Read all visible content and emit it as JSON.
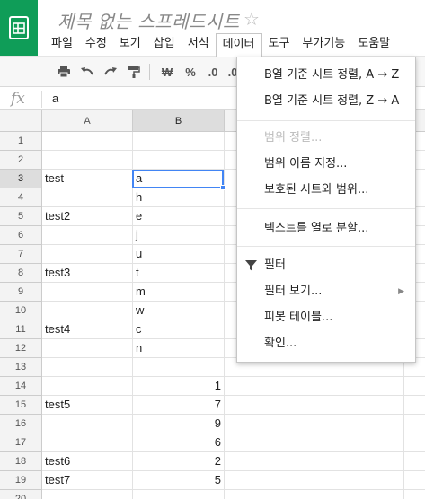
{
  "app": {
    "title": "제목 없는 스프레드시트",
    "star": "☆",
    "brand_color": "#0f9d58"
  },
  "menubar": {
    "items": [
      "파일",
      "수정",
      "보기",
      "삽입",
      "서식",
      "데이터",
      "도구",
      "부가기능",
      "도움말"
    ],
    "active_index": 5
  },
  "toolbar": {
    "print_icon": "print-icon",
    "undo_icon": "undo-icon",
    "redo_icon": "redo-icon",
    "paint_format_icon": "paint-format-icon",
    "currency_label": "₩",
    "percent_label": "%",
    "decimal_decrease_label": ".0",
    "decimal_increase_label": ".0"
  },
  "formula_bar": {
    "fx_label": "fx",
    "value": "a"
  },
  "grid": {
    "columns": [
      "A",
      "B"
    ],
    "selected_column": "B",
    "selected_row": 3,
    "rows": [
      {
        "n": "1",
        "a": "",
        "b": "",
        "b_num": false
      },
      {
        "n": "2",
        "a": "",
        "b": "",
        "b_num": false
      },
      {
        "n": "3",
        "a": "test",
        "b": "a",
        "b_num": false
      },
      {
        "n": "4",
        "a": "",
        "b": "h",
        "b_num": false
      },
      {
        "n": "5",
        "a": "test2",
        "b": "e",
        "b_num": false
      },
      {
        "n": "6",
        "a": "",
        "b": "j",
        "b_num": false
      },
      {
        "n": "7",
        "a": "",
        "b": "u",
        "b_num": false
      },
      {
        "n": "8",
        "a": "test3",
        "b": "t",
        "b_num": false
      },
      {
        "n": "9",
        "a": "",
        "b": "m",
        "b_num": false
      },
      {
        "n": "10",
        "a": "",
        "b": "w",
        "b_num": false
      },
      {
        "n": "11",
        "a": "test4",
        "b": "c",
        "b_num": false
      },
      {
        "n": "12",
        "a": "",
        "b": "n",
        "b_num": false
      },
      {
        "n": "13",
        "a": "",
        "b": "",
        "b_num": false
      },
      {
        "n": "14",
        "a": "",
        "b": "1",
        "b_num": true
      },
      {
        "n": "15",
        "a": "test5",
        "b": "7",
        "b_num": true
      },
      {
        "n": "16",
        "a": "",
        "b": "9",
        "b_num": true
      },
      {
        "n": "17",
        "a": "",
        "b": "6",
        "b_num": true
      },
      {
        "n": "18",
        "a": "test6",
        "b": "2",
        "b_num": true
      },
      {
        "n": "19",
        "a": "test7",
        "b": "5",
        "b_num": true
      },
      {
        "n": "20",
        "a": "",
        "b": "",
        "b_num": false
      }
    ]
  },
  "data_menu": {
    "sort_a_z": "B열 기준 시트 정렬, A → Z",
    "sort_z_a": "B열 기준 시트 정렬, Z → A",
    "sort_range": "범위 정렬...",
    "named_ranges": "범위 이름 지정...",
    "protected": "보호된 시트와 범위...",
    "split_text": "텍스트를 열로 분할...",
    "filter": "필터",
    "filter_views": "필터 보기...",
    "pivot": "피봇 테이블...",
    "validation": "확인..."
  }
}
